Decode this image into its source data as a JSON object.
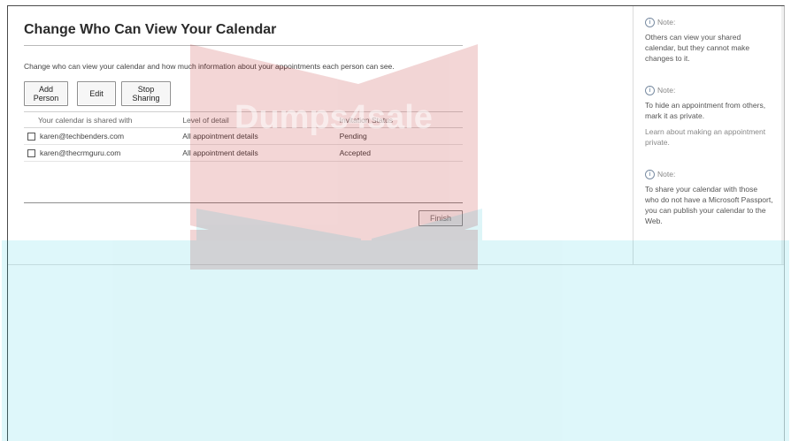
{
  "page": {
    "title": "Change Who Can View Your Calendar",
    "description": "Change who can view your calendar and how much information about your appointments each person can see."
  },
  "toolbar": {
    "add_label": "Add Person",
    "edit_label": "Edit",
    "stop_label": "Stop Sharing"
  },
  "table": {
    "headers": [
      "Your calendar is shared with",
      "Level of detail",
      "Invitation Status"
    ],
    "rows": [
      {
        "email": "karen@techbenders.com",
        "detail": "All appointment details",
        "status": "Pending"
      },
      {
        "email": "karen@thecrmguru.com",
        "detail": "All appointment details",
        "status": "Accepted"
      }
    ]
  },
  "finish_label": "Finish",
  "sidebar": {
    "note_label": "Note:",
    "notes": [
      {
        "text": "Others can view your shared calendar, but they cannot make changes to it."
      },
      {
        "text": "To hide an appointment from others, mark it as private.",
        "link": "Learn about making an appointment private."
      },
      {
        "text": "To share your calendar with those who do not have a Microsoft Passport, you can publish your calendar to the Web."
      }
    ]
  },
  "icons": {
    "note": "info-icon"
  },
  "watermark": {
    "text": "Dumps4sale"
  }
}
